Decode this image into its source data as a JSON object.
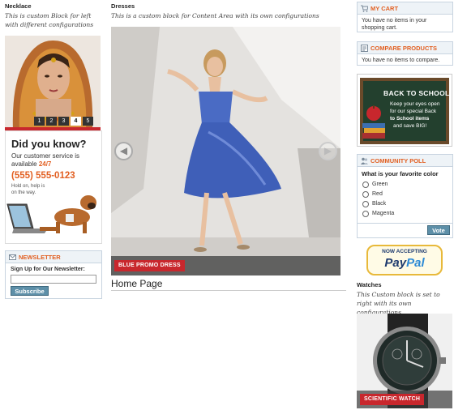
{
  "left": {
    "necklace_title": "Necklace",
    "necklace_desc": "This is custom Block for left with different configurations",
    "slider_pages": [
      "1",
      "2",
      "3",
      "4",
      "5"
    ],
    "slider_active": "4",
    "service": {
      "heading": "Did you know?",
      "line1": "Our customer service is",
      "line2_prefix": "available ",
      "line2_hl": "24/7",
      "phone": "(555) 555-0123",
      "note1": "Hold on, help is",
      "note2": "on the way."
    },
    "newsletter": {
      "title": "NEWSLETTER",
      "label": "Sign Up for Our Newsletter:",
      "input_value": "",
      "button": "Subscribe"
    }
  },
  "center": {
    "dresses_title": "Dresses",
    "dresses_desc": "This is a custom block for Content Area with its own configurations",
    "slide_caption": "BLUE PROMO DRESS",
    "page_heading": "Home Page"
  },
  "right": {
    "cart": {
      "title": "MY CART",
      "text": "You have no items in your shopping cart."
    },
    "compare": {
      "title": "COMPARE PRODUCTS",
      "text": "You have no items to compare."
    },
    "school": {
      "line1": "BACK TO SCHOOL",
      "line2": "Keep your eyes open",
      "line3": "for our special Back",
      "line4": "to School items",
      "line5": "and save BIG!"
    },
    "poll": {
      "title": "COMMUNITY POLL",
      "question": "What is your favorite color",
      "options": [
        "Green",
        "Red",
        "Black",
        "Magenta"
      ],
      "button": "Vote"
    },
    "paypal": {
      "small": "NOW ACCEPTING",
      "pay": "Pay",
      "pal": "Pal"
    },
    "watches_title": "Watches",
    "watches_desc": "This Custom block is set to right with its own configurations",
    "watch_caption": "SCIENTIFIC WATCH"
  },
  "colors": {
    "accent_orange": "#e25f21",
    "label_red": "#c8272d",
    "button_blue": "#5d8fa8",
    "box_border": "#c8d4e0"
  }
}
